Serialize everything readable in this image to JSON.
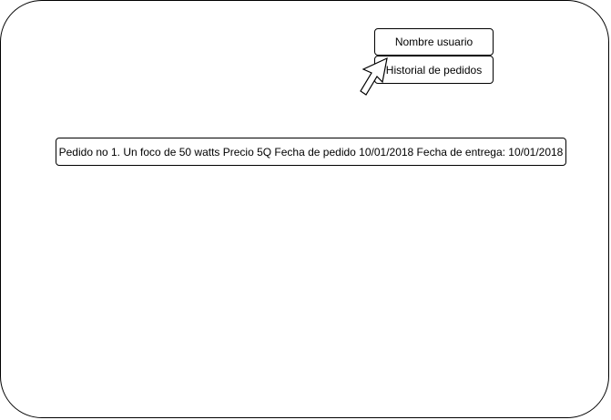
{
  "header": {
    "user_button_label": "Nombre usuario",
    "history_button_label": "Historial de pedidos"
  },
  "orders": [
    {
      "text": "Pedido no 1. Un foco de 50 watts Precio 5Q Fecha de pedido 10/01/2018 Fecha de entrega: 10/01/2018"
    }
  ],
  "cursor": {
    "icon": "arrow-cursor-icon"
  }
}
